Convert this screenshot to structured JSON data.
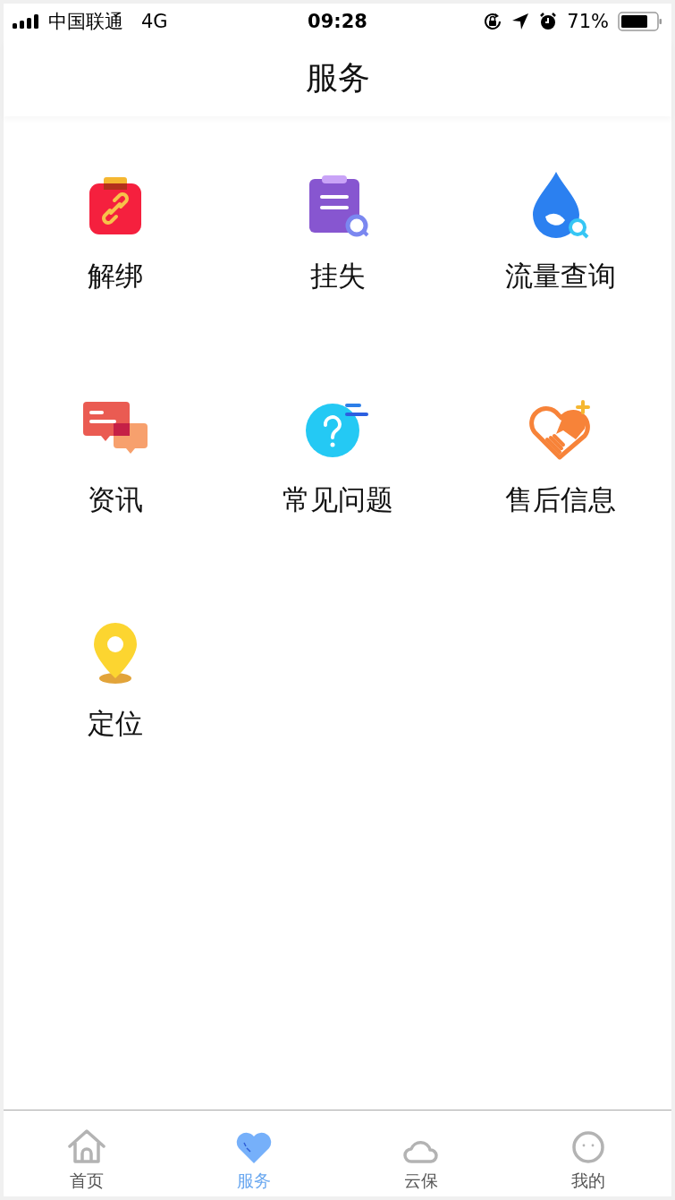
{
  "status_bar": {
    "carrier": "中国联通",
    "network": "4G",
    "time": "09:28",
    "battery": "71%"
  },
  "header": {
    "title": "服务"
  },
  "services": [
    {
      "kind": "unbind",
      "label": "解绑"
    },
    {
      "kind": "report-loss",
      "label": "挂失"
    },
    {
      "kind": "data-usage",
      "label": "流量查询"
    },
    {
      "kind": "news",
      "label": "资讯"
    },
    {
      "kind": "faq",
      "label": "常见问题"
    },
    {
      "kind": "after-sales",
      "label": "售后信息"
    },
    {
      "kind": "location",
      "label": "定位"
    }
  ],
  "tab_bar": [
    {
      "kind": "home",
      "label": "首页",
      "selected": false
    },
    {
      "kind": "heart",
      "label": "服务",
      "selected": true
    },
    {
      "kind": "cloud",
      "label": "云保",
      "selected": false
    },
    {
      "kind": "face",
      "label": "我的",
      "selected": false
    }
  ]
}
